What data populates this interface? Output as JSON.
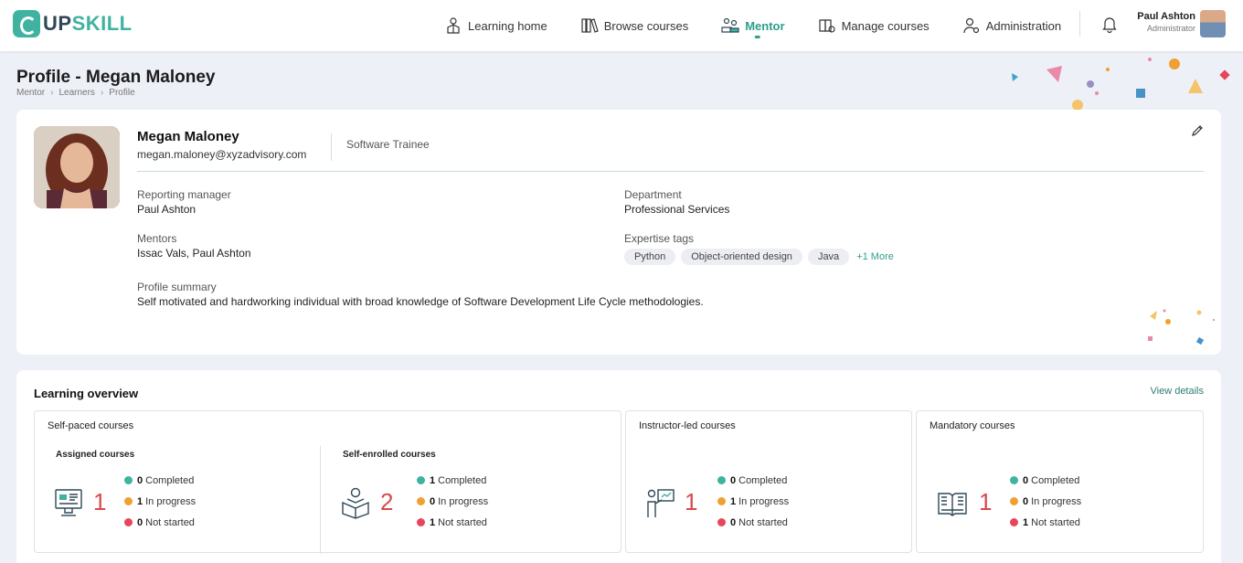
{
  "brand": {
    "logo_prefix": "UP",
    "logo_suffix": "SKILL"
  },
  "nav": {
    "items": [
      {
        "label": "Learning home",
        "icon": "learner-icon"
      },
      {
        "label": "Browse courses",
        "icon": "books-icon"
      },
      {
        "label": "Mentor",
        "icon": "mentor-icon",
        "active": true
      },
      {
        "label": "Manage courses",
        "icon": "manage-courses-icon"
      },
      {
        "label": "Administration",
        "icon": "admin-icon"
      }
    ]
  },
  "user": {
    "name": "Paul Ashton",
    "role": "Administrator"
  },
  "page": {
    "title": "Profile - Megan Maloney",
    "breadcrumb": [
      "Mentor",
      "Learners",
      "Profile"
    ]
  },
  "profile": {
    "name": "Megan Maloney",
    "email": "megan.maloney@xyzadvisory.com",
    "job_title": "Software Trainee",
    "reporting_manager_label": "Reporting manager",
    "reporting_manager": "Paul Ashton",
    "department_label": "Department",
    "department": "Professional Services",
    "mentors_label": "Mentors",
    "mentors": "Issac Vals, Paul Ashton",
    "expertise_label": "Expertise tags",
    "tags": [
      "Python",
      "Object-oriented design",
      "Java"
    ],
    "more_tags": "+1 More",
    "summary_label": "Profile summary",
    "summary": "Self motivated and hardworking individual with broad knowledge of Software Development Life Cycle methodologies."
  },
  "overview": {
    "title": "Learning overview",
    "view_details": "View details",
    "self_paced": {
      "title": "Self-paced courses",
      "assigned": {
        "title": "Assigned courses",
        "total": "1",
        "completed": "0",
        "in_progress": "1",
        "not_started": "0"
      },
      "self_enrolled": {
        "title": "Self-enrolled courses",
        "total": "2",
        "completed": "1",
        "in_progress": "0",
        "not_started": "1"
      }
    },
    "instructor_led": {
      "title": "Instructor-led courses",
      "total": "1",
      "completed": "0",
      "in_progress": "1",
      "not_started": "0"
    },
    "mandatory": {
      "title": "Mandatory courses",
      "total": "1",
      "completed": "0",
      "in_progress": "0",
      "not_started": "1"
    },
    "labels": {
      "completed": "Completed",
      "in_progress": "In progress",
      "not_started": "Not started"
    }
  },
  "colors": {
    "accent": "#2e9e8a",
    "completed": "#3fb3a0",
    "in_progress": "#f0a030",
    "not_started": "#e8455a",
    "count": "#d94a4a"
  }
}
